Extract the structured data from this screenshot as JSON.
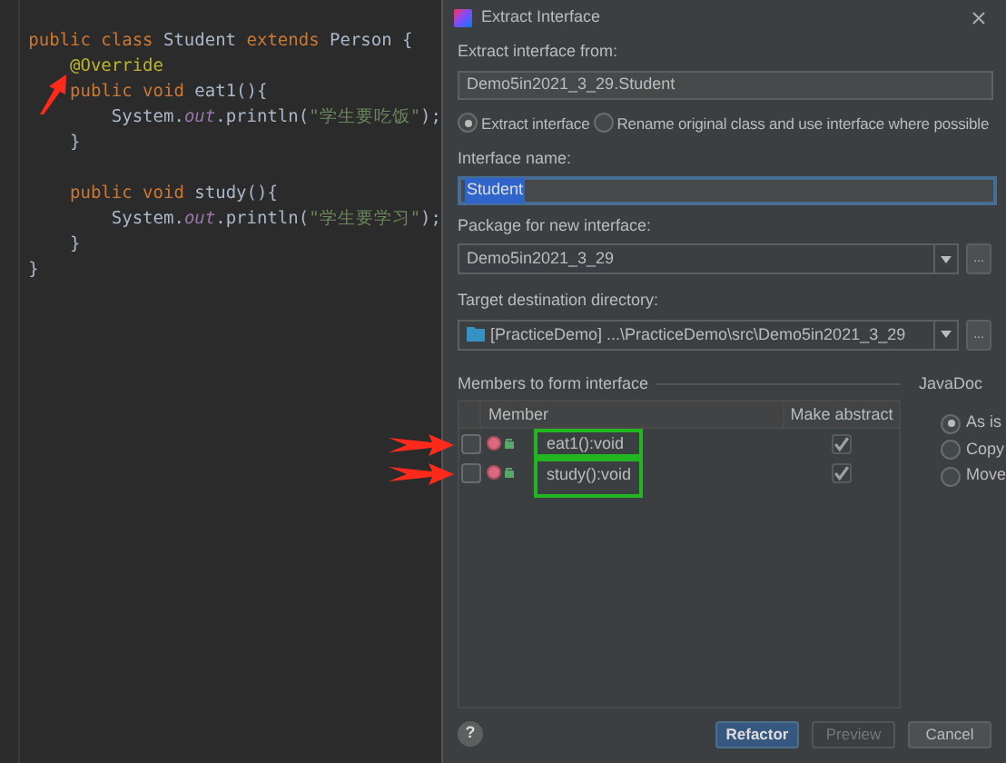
{
  "editor": {
    "lines": [
      {
        "tokens": [
          {
            "text": "public class ",
            "kind": "keyword"
          },
          {
            "text": "Student ",
            "kind": "class"
          },
          {
            "text": "extends ",
            "kind": "keyword"
          },
          {
            "text": "Person {",
            "kind": "plain"
          }
        ]
      },
      {
        "tokens": [
          {
            "text": "    @Override",
            "kind": "annotation"
          }
        ]
      },
      {
        "tokens": [
          {
            "text": "    public void ",
            "kind": "keyword"
          },
          {
            "text": "eat1",
            "kind": "class"
          },
          {
            "text": "(){",
            "kind": "plain"
          }
        ]
      },
      {
        "tokens": [
          {
            "text": "        System.",
            "kind": "plain"
          },
          {
            "text": "out",
            "kind": "field"
          },
          {
            "text": ".println(",
            "kind": "plain"
          },
          {
            "text": "\"学生要吃饭\"",
            "kind": "string"
          },
          {
            "text": ");",
            "kind": "plain"
          }
        ]
      },
      {
        "tokens": [
          {
            "text": "    }",
            "kind": "plain"
          }
        ]
      },
      {
        "gap_before": true,
        "tokens": [
          {
            "text": "    public void ",
            "kind": "keyword"
          },
          {
            "text": "study",
            "kind": "class"
          },
          {
            "text": "(){",
            "kind": "plain"
          }
        ]
      },
      {
        "tokens": [
          {
            "text": "        System.",
            "kind": "plain"
          },
          {
            "text": "out",
            "kind": "field"
          },
          {
            "text": ".println(",
            "kind": "plain"
          },
          {
            "text": "\"学生要学习\"",
            "kind": "string"
          },
          {
            "text": ");",
            "kind": "plain"
          }
        ]
      },
      {
        "tokens": [
          {
            "text": "    }",
            "kind": "plain"
          }
        ]
      },
      {
        "tokens": [
          {
            "text": "}",
            "kind": "plain"
          }
        ]
      }
    ]
  },
  "dialog": {
    "title": "Extract Interface",
    "from_label": "Extract interface from:",
    "from_value": "Demo5in2021_3_29.Student",
    "modes": [
      {
        "label": "Extract interface",
        "selected": true
      },
      {
        "label": "Rename original class and use interface where possible",
        "selected": false
      }
    ],
    "name_label": "Interface name:",
    "name_value": "Student",
    "package_label": "Package for new interface:",
    "package_value": "Demo5in2021_3_29",
    "package_browse": "...",
    "target_label": "Target destination directory:",
    "target_value": "[PracticeDemo] ...\\PracticeDemo\\src\\Demo5in2021_3_29",
    "target_browse": "...",
    "members_label": "Members to form interface",
    "columns": [
      "Member",
      "Make abstract"
    ],
    "members": [
      {
        "name": "eat1():void",
        "checked": false,
        "abstract": true
      },
      {
        "name": "study():void",
        "checked": false,
        "abstract": true
      }
    ],
    "javadoc_label": "JavaDoc",
    "javadoc": [
      {
        "label": "As is",
        "selected": true
      },
      {
        "label": "Copy",
        "selected": false
      },
      {
        "label": "Move",
        "selected": false
      }
    ],
    "help": "?",
    "buttons": [
      {
        "label": "Refactor",
        "kind": "primary"
      },
      {
        "label": "Preview",
        "kind": "disabled"
      },
      {
        "label": "Cancel",
        "kind": "normal"
      }
    ]
  }
}
